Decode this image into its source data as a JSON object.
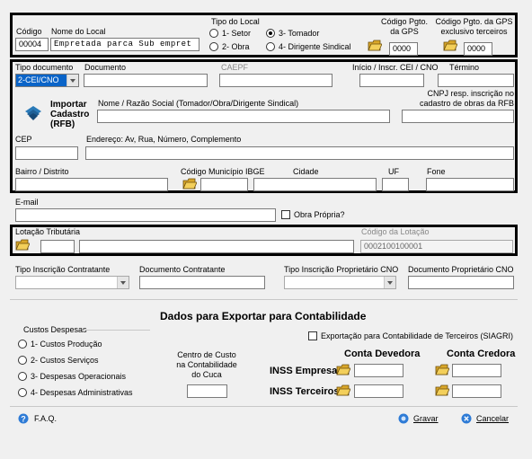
{
  "top": {
    "codigo_label": "Código",
    "codigo_value": "00004",
    "nome_label": "Nome do Local",
    "nome_value": "Empretada parca Sub empret",
    "tipo_local_label": "Tipo do Local",
    "opt_setor": "1- Setor",
    "opt_tomador": "3- Tomador",
    "opt_obra": "2- Obra",
    "opt_dirigente": "4- Dirigente Sindical",
    "cod_pgto_label_1": "Código Pgto.",
    "cod_pgto_label_2": "da GPS",
    "cod_pgto_value": "0000",
    "cod_terc_label_1": "Código Pgto. da GPS",
    "cod_terc_label_2": "exclusivo terceiros",
    "cod_terc_value": "0000"
  },
  "doc": {
    "tipo_doc_label": "Tipo documento",
    "tipo_doc_value": "2-CEI/CNO",
    "documento_label": "Documento",
    "caepf_label": "CAEPF",
    "inicio_label": "Início / Inscr. CEI / CNO",
    "termino_label": "Término",
    "importar_1": "Importar",
    "importar_2": "Cadastro",
    "importar_3": "(RFB)",
    "nome_razao_label": "Nome / Razão Social (Tomador/Obra/Dirigente Sindical)",
    "cnpj_label_1": "CNPJ resp. inscrição no",
    "cnpj_label_2": "cadastro de obras da RFB",
    "cep_label": "CEP",
    "endereco_label": "Endereço: Av, Rua, Número, Complemento",
    "bairro_label": "Bairro / Distrito",
    "cod_mun_label": "Código Município IBGE",
    "cidade_label": "Cidade",
    "uf_label": "UF",
    "fone_label": "Fone"
  },
  "email": {
    "label": "E-mail",
    "obra_propria": "Obra Própria?"
  },
  "lotacao": {
    "label": "Lotação Tributária",
    "cod_label": "Código da Lotação",
    "cod_value": "0002100100001"
  },
  "contratante": {
    "tipo_insc_label": "Tipo Inscrição Contratante",
    "doc_contr_label": "Documento Contratante",
    "tipo_prop_label": "Tipo Inscrição Proprietário CNO",
    "doc_prop_label": "Documento Proprietário CNO"
  },
  "contab": {
    "title": "Dados para Exportar para Contabilidade",
    "custos_label": "Custos Despesas",
    "opt1": "1- Custos Produção",
    "opt2": "2- Custos Serviços",
    "opt3": "3- Despesas Operacionais",
    "opt4": "4- Despesas Administrativas",
    "centro_1": "Centro de Custo",
    "centro_2": "na Contabilidade",
    "centro_3": "do Cuca",
    "exportacao": "Exportação para Contabilidade de Terceiros (SIAGRI)",
    "conta_devedora": "Conta Devedora",
    "conta_credora": "Conta Credora",
    "inss_empresa": "INSS Empresa",
    "inss_terceiros": "INSS Terceiros"
  },
  "footer": {
    "faq": "F.A.Q.",
    "gravar": "Gravar",
    "cancelar": "Cancelar"
  }
}
